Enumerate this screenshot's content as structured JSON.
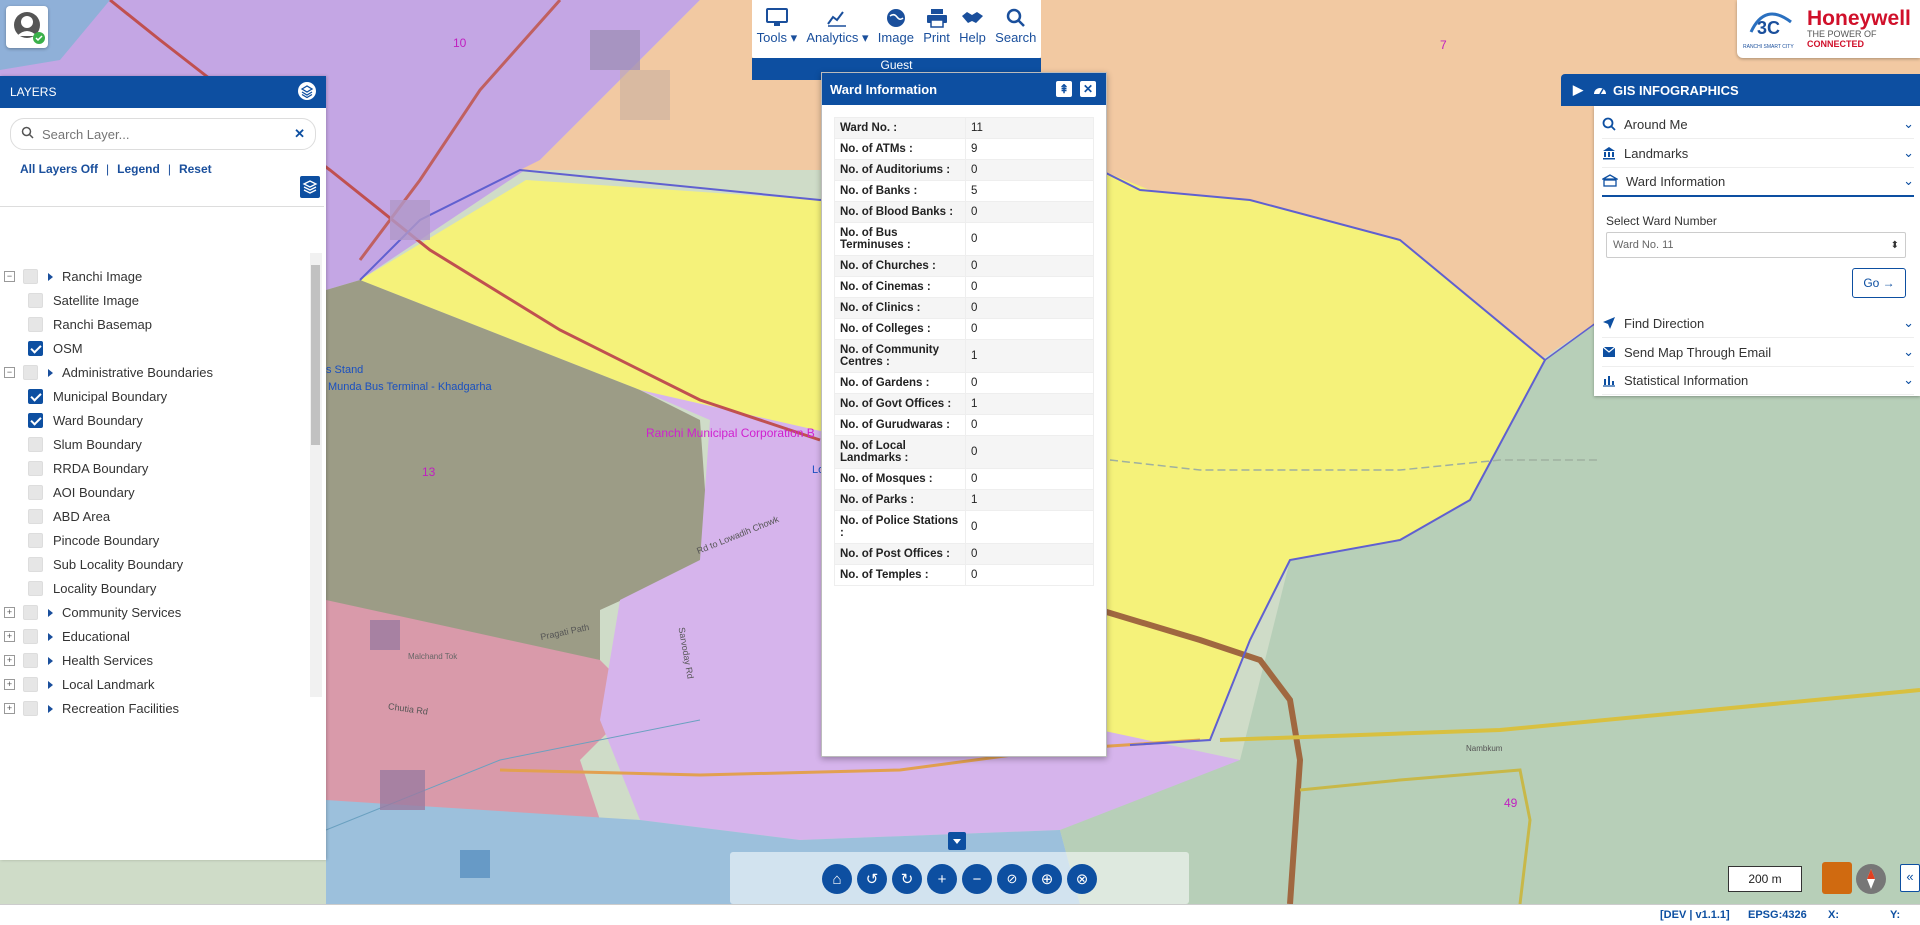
{
  "map": {
    "ward_labels": [
      "10",
      "7",
      "13",
      "49"
    ],
    "place_labels": [
      "s Stand",
      "Munda Bus Terminal - Khadgarha",
      "Ranchi Municipal Corporation B",
      "Lo"
    ],
    "road_labels": [
      "Rd to Lowadih Chowk",
      "Pragati Path",
      "Sarvoday Rd",
      "Chutia Rd",
      "Malchand Tok",
      "Nambkum"
    ]
  },
  "toolbar": {
    "items": [
      "Tools",
      "Analytics",
      "Image",
      "Print",
      "Help",
      "Search"
    ],
    "user_label": "Guest"
  },
  "logo": {
    "brand": "Honeywell",
    "tagline_prefix": "THE POWER OF",
    "tagline_strong": "CONNECTED",
    "city_caption": "RANCHI SMART CITY"
  },
  "layers": {
    "title": "LAYERS",
    "search_placeholder": "Search Layer...",
    "links": [
      "All Layers Off",
      "Legend",
      "Reset"
    ],
    "items": [
      {
        "label": "Ranchi Image"
      },
      {
        "label": "Satellite Image",
        "checked": false
      },
      {
        "label": "Ranchi Basemap",
        "checked": false
      },
      {
        "label": "OSM",
        "checked": true
      },
      {
        "label": "Administrative Boundaries"
      },
      {
        "label": "Municipal Boundary",
        "checked": true
      },
      {
        "label": "Ward Boundary",
        "checked": true
      },
      {
        "label": "Slum Boundary",
        "checked": false
      },
      {
        "label": "RRDA Boundary",
        "checked": false
      },
      {
        "label": "AOI Boundary",
        "checked": false
      },
      {
        "label": "ABD Area",
        "checked": false
      },
      {
        "label": "Pincode Boundary",
        "checked": false
      },
      {
        "label": "Sub Locality Boundary",
        "checked": false
      },
      {
        "label": "Locality Boundary",
        "checked": false
      },
      {
        "label": "Community Services"
      },
      {
        "label": "Educational"
      },
      {
        "label": "Health Services"
      },
      {
        "label": "Local Landmark"
      },
      {
        "label": "Recreation Facilities"
      }
    ]
  },
  "ward_info": {
    "title": "Ward Information",
    "rows": [
      {
        "k": "Ward No. :",
        "v": "11"
      },
      {
        "k": "No. of ATMs :",
        "v": "9"
      },
      {
        "k": "No. of Auditoriums :",
        "v": "0"
      },
      {
        "k": "No. of Banks :",
        "v": "5"
      },
      {
        "k": "No. of Blood Banks :",
        "v": "0"
      },
      {
        "k": "No. of Bus Terminuses :",
        "v": "0"
      },
      {
        "k": "No. of Churches :",
        "v": "0"
      },
      {
        "k": "No. of Cinemas :",
        "v": "0"
      },
      {
        "k": "No. of Clinics :",
        "v": "0"
      },
      {
        "k": "No. of Colleges :",
        "v": "0"
      },
      {
        "k": "No. of Community Centres :",
        "v": "1"
      },
      {
        "k": "No. of Gardens :",
        "v": "0"
      },
      {
        "k": "No. of Govt Offices :",
        "v": "1"
      },
      {
        "k": "No. of Gurudwaras :",
        "v": "0"
      },
      {
        "k": "No. of Local Landmarks :",
        "v": "0"
      },
      {
        "k": "No. of Mosques :",
        "v": "0"
      },
      {
        "k": "No. of Parks :",
        "v": "1"
      },
      {
        "k": "No. of Police Stations :",
        "v": "0"
      },
      {
        "k": "No. of Post Offices :",
        "v": "0"
      },
      {
        "k": "No. of Temples :",
        "v": "0"
      }
    ]
  },
  "gis": {
    "title": "GIS INFOGRAPHICS",
    "around_me": "Around Me",
    "landmarks": "Landmarks",
    "ward_information": "Ward Information",
    "select_label": "Select Ward Number",
    "selected_ward": "Ward No. 11",
    "go": "Go",
    "find_direction": "Find Direction",
    "send_map": "Send Map Through Email",
    "statistical": "Statistical Information"
  },
  "scale": "200 m",
  "status": {
    "version": "[DEV | v1.1.1]",
    "epsg": "EPSG:4326",
    "x": "X:",
    "y": "Y:"
  },
  "colors": {
    "primary": "#0d4fa1",
    "ward_highlight": "#f5f27a"
  }
}
